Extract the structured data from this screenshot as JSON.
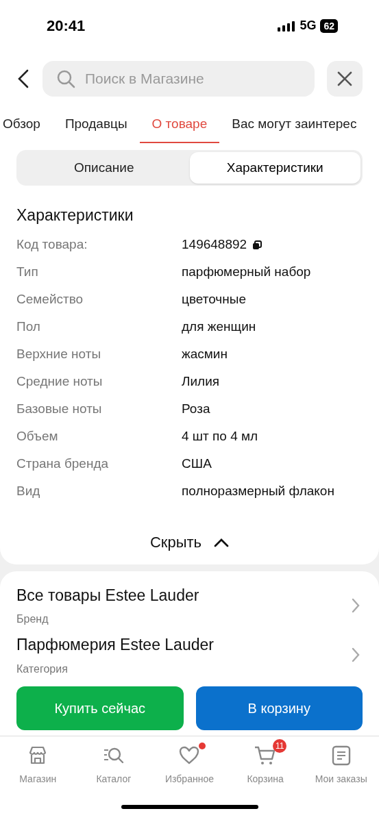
{
  "status_bar": {
    "time": "20:41",
    "network": "5G",
    "battery": "62"
  },
  "search": {
    "placeholder": "Поиск в Магазине"
  },
  "tabs": [
    {
      "label": "Обзор",
      "selected": false
    },
    {
      "label": "Продавцы",
      "selected": false
    },
    {
      "label": "О товаре",
      "selected": true
    },
    {
      "label": "Вас могут заинтерес",
      "selected": false
    }
  ],
  "segments": [
    {
      "label": "Описание",
      "selected": false
    },
    {
      "label": "Характеристики",
      "selected": true
    }
  ],
  "specs": {
    "title": "Характеристики",
    "rows": [
      {
        "label": "Код товара:",
        "value": "149648892",
        "copyable": true
      },
      {
        "label": "Тип",
        "value": "парфюмерный набор",
        "copyable": false
      },
      {
        "label": "Семейство",
        "value": "цветочные",
        "copyable": false
      },
      {
        "label": "Пол",
        "value": "для женщин",
        "copyable": false
      },
      {
        "label": "Верхние ноты",
        "value": "жасмин",
        "copyable": false
      },
      {
        "label": "Средние ноты",
        "value": "Лилия",
        "copyable": false
      },
      {
        "label": "Базовые ноты",
        "value": "Роза",
        "copyable": false
      },
      {
        "label": "Объем",
        "value": "4 шт по 4 мл",
        "copyable": false
      },
      {
        "label": "Страна бренда",
        "value": "США",
        "copyable": false
      },
      {
        "label": "Вид",
        "value": "полноразмерный флакон",
        "copyable": false
      }
    ],
    "collapse_label": "Скрыть"
  },
  "links": [
    {
      "title": "Все товары Estee Lauder",
      "subtitle": "Бренд"
    },
    {
      "title": "Парфюмерия Estee Lauder",
      "subtitle": "Категория"
    }
  ],
  "actions": [
    {
      "kind": "buy",
      "label": "Купить сейчас"
    },
    {
      "kind": "cart",
      "label": "В корзину"
    }
  ],
  "bottom_nav": [
    {
      "kind": "shop",
      "label": "Магазин",
      "dot": false
    },
    {
      "kind": "catalog",
      "label": "Каталог",
      "dot": false
    },
    {
      "kind": "favorites",
      "label": "Избранное",
      "dot": true
    },
    {
      "kind": "cart",
      "label": "Корзина",
      "dot": false,
      "badge": "11"
    },
    {
      "kind": "orders",
      "label": "Мои заказы",
      "dot": false
    }
  ]
}
